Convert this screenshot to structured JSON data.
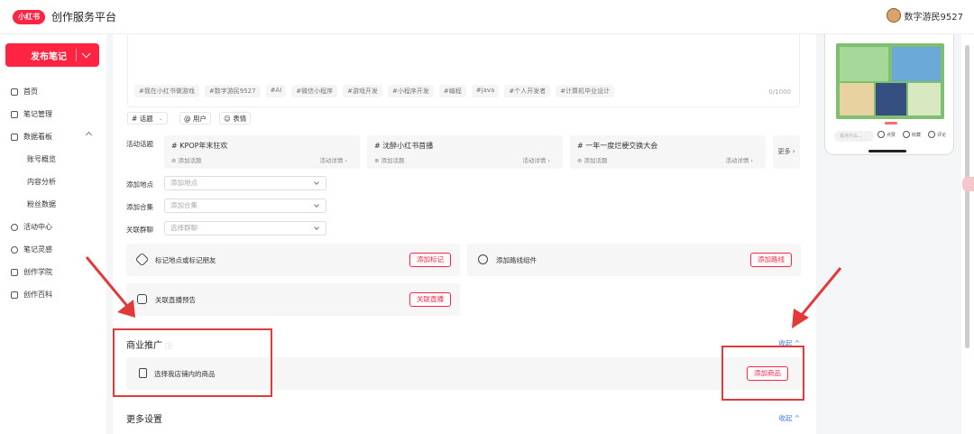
{
  "header": {
    "logo_text": "小红书",
    "title": "创作服务平台",
    "username": "数字游民9527"
  },
  "sidebar": {
    "publish_label": "发布笔记",
    "items": [
      {
        "label": "首页",
        "icon": "home-icon"
      },
      {
        "label": "笔记管理",
        "icon": "note-icon"
      },
      {
        "label": "数据看板",
        "icon": "chart-icon"
      },
      {
        "label": "账号概览"
      },
      {
        "label": "内容分析"
      },
      {
        "label": "粉丝数据"
      },
      {
        "label": "活动中心",
        "icon": "activity-icon"
      },
      {
        "label": "笔记灵感",
        "icon": "bulb-icon"
      },
      {
        "label": "创作学院",
        "icon": "school-icon"
      },
      {
        "label": "创作百科",
        "icon": "book-icon"
      }
    ]
  },
  "editor": {
    "tags": [
      "#我在小红书做游戏",
      "#数字游民9527",
      "#AI",
      "#微信小程序",
      "#游戏开发",
      "#小程序开发",
      "#编程",
      "#java",
      "#个人开发者",
      "#计算机毕业设计"
    ],
    "counter": "0/1000",
    "tools": [
      "# 话题",
      "@ 用户",
      "☺ 表情"
    ]
  },
  "activity": {
    "label": "活动话题",
    "add_label": "添加话题",
    "detail_label": "活动详情 ›",
    "more_label": "更多 ›",
    "cards": [
      {
        "title": "# KPOP年末狂欢"
      },
      {
        "title": "# 沈醉小红书首播"
      },
      {
        "title": "# 一年一度烂梗交换大会"
      }
    ]
  },
  "fields": [
    {
      "label": "添加地点",
      "placeholder": "添加地点"
    },
    {
      "label": "添加合集",
      "placeholder": "添加合集"
    },
    {
      "label": "关联群聊",
      "placeholder": "选择群聊"
    }
  ],
  "components": {
    "mark": {
      "text": "标记地点或标记朋友",
      "button": "添加标记"
    },
    "route": {
      "text": "添加路线组件",
      "button": "添加路线"
    },
    "live": {
      "text": "关联直播预告",
      "button": "关联直播"
    }
  },
  "commerce": {
    "title": "商业推广",
    "collapse": "收起 ^",
    "product_text": "选择我店铺内的商品",
    "product_button": "添加商品"
  },
  "more_settings": {
    "title": "更多设置",
    "collapse": "收起 ^"
  },
  "preview": {
    "comment_placeholder": "说点什么...",
    "actions": [
      "点赞",
      "收藏",
      "评论"
    ]
  },
  "colors": {
    "brand": "#ff2442",
    "link": "#3d7bd9",
    "annotation": "#e03a3a"
  }
}
